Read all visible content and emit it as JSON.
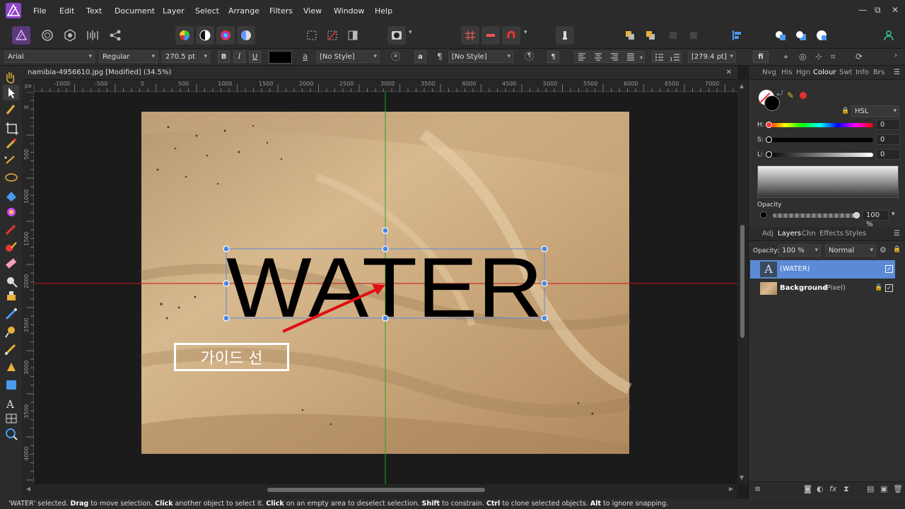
{
  "menubar": {
    "items": [
      "File",
      "Edit",
      "Text",
      "Document",
      "Layer",
      "Select",
      "Arrange",
      "Filters",
      "View",
      "Window",
      "Help"
    ],
    "window_controls": {
      "minimize": "—",
      "restore": "⧉",
      "close": "✕"
    }
  },
  "context_toolbar": {
    "font_family": "Arial",
    "font_style": "Regular",
    "font_size": "270.5 pt",
    "bold": "B",
    "italic": "I",
    "underline": "U",
    "char_style_icon": "a",
    "char_style": "[No Style]",
    "char_a_icon": "a",
    "para_icon": "¶",
    "para_style": "[No Style]",
    "para_icon2": "¶",
    "leading": "[279.4 pt]",
    "fi_icon": "fi"
  },
  "document": {
    "tab_title": "namibia-4956610.jpg [Modified] (34.5%)",
    "close": "✕",
    "ruler_unit": "px",
    "h_ticks": [
      "-1000",
      "-500",
      "0",
      "500",
      "1000",
      "1500",
      "2000",
      "2500",
      "3000",
      "3500",
      "4000",
      "4500",
      "5000",
      "5500",
      "6000",
      "6500",
      "7000"
    ],
    "v_ticks": [
      "0",
      "500",
      "1000",
      "1500",
      "2000",
      "2500",
      "3000",
      "3500",
      "4000"
    ],
    "text_layer_content": "WATER",
    "annotation_label": "가이드 선",
    "guide_colors": {
      "vertical": "#22aa22",
      "horizontal": "#cc1111"
    },
    "arrow_color": "#e01010"
  },
  "status": {
    "segments": [
      {
        "t": "'WATER' selected. ",
        "b": false
      },
      {
        "t": "Drag",
        "b": true
      },
      {
        "t": " to move selection. ",
        "b": false
      },
      {
        "t": "Click",
        "b": true
      },
      {
        "t": " another object to select it. ",
        "b": false
      },
      {
        "t": "Click",
        "b": true
      },
      {
        "t": " on an empty area to deselect selection. ",
        "b": false
      },
      {
        "t": "Shift",
        "b": true
      },
      {
        "t": " to constrain. ",
        "b": false
      },
      {
        "t": "Ctrl",
        "b": true
      },
      {
        "t": " to clone selected objects. ",
        "b": false
      },
      {
        "t": "Alt",
        "b": true
      },
      {
        "t": " to ignore snapping.",
        "b": false
      }
    ]
  },
  "colour_panel": {
    "tabs": [
      "Nvg",
      "His",
      "Hgn",
      "Colour",
      "Swt",
      "Info",
      "Brs"
    ],
    "active_tab": "Colour",
    "model": "HSL",
    "h_label": "H:",
    "s_label": "S:",
    "l_label": "L:",
    "h_value": "0",
    "s_value": "0",
    "l_value": "0",
    "opacity_label": "Opacity",
    "opacity_value": "100 %",
    "accent_red": "#e03030"
  },
  "layers_panel": {
    "tabs": [
      "Adj",
      "Layers",
      "Chn",
      "Effects",
      "Styles"
    ],
    "active_tab": "Layers",
    "opacity_label": "Opacity:",
    "opacity_value": "100 %",
    "blend_mode": "Normal",
    "layers": [
      {
        "name": "(WATER)",
        "type": "",
        "selected": true,
        "thumb": "A"
      },
      {
        "name": "Background",
        "type": " (Pixel)",
        "selected": false,
        "thumb": ""
      }
    ],
    "selection_color": "#5b8ad6"
  }
}
